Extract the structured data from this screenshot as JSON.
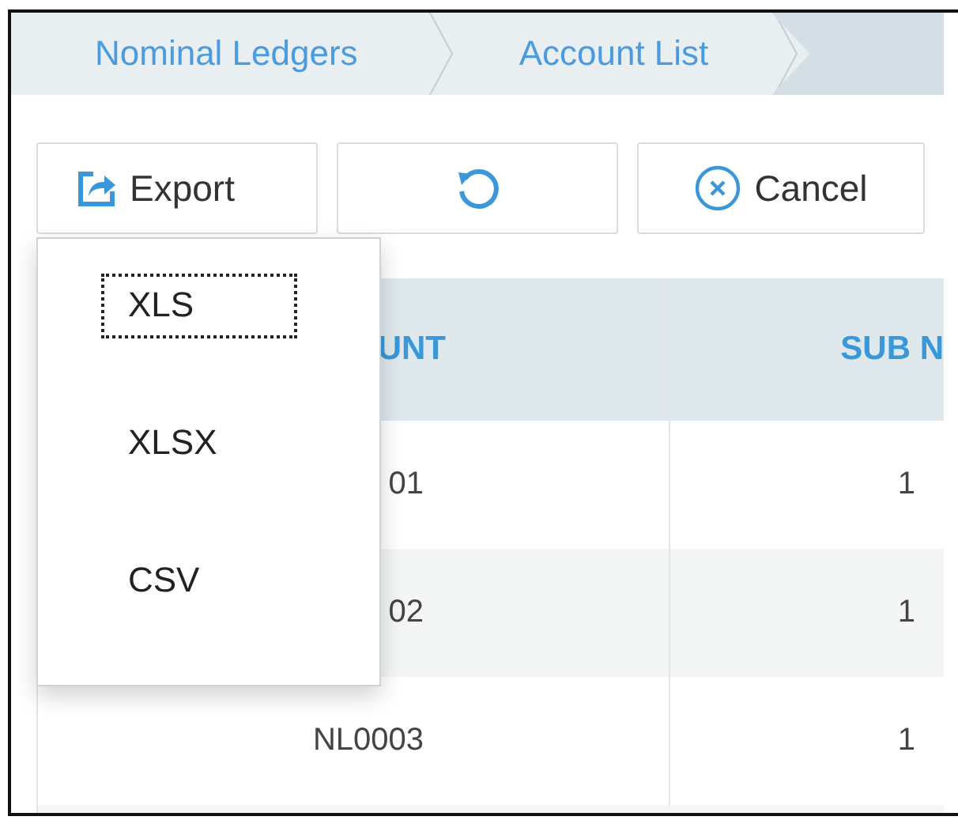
{
  "breadcrumb": [
    {
      "label": "Nominal Ledgers"
    },
    {
      "label": "Account List"
    }
  ],
  "toolbar": [
    {
      "kind": "export",
      "label": "Export"
    },
    {
      "kind": "refresh"
    },
    {
      "kind": "cancel",
      "label": "Cancel"
    }
  ],
  "export_menu": {
    "items": [
      {
        "label": "XLS",
        "focused": true
      },
      {
        "label": "XLSX",
        "focused": false
      },
      {
        "label": "CSV",
        "focused": false
      }
    ]
  },
  "table": {
    "columns": [
      "UNT",
      "SUB N"
    ],
    "rows": [
      [
        "01",
        "1"
      ],
      [
        "02",
        "1"
      ],
      [
        "NL0003",
        "1"
      ]
    ]
  }
}
